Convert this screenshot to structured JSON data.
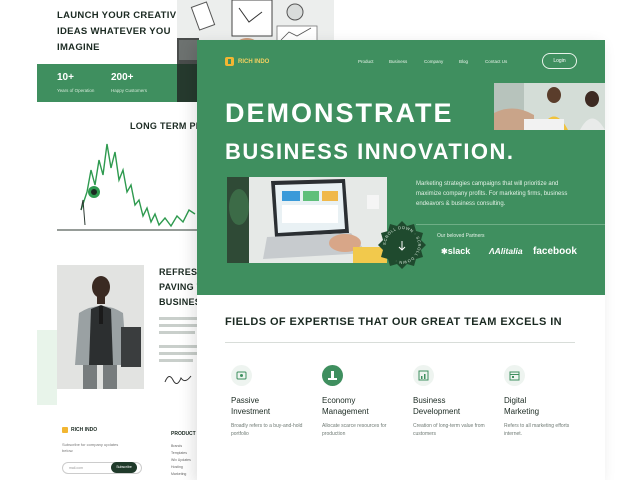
{
  "back_page": {
    "hero_title": "LAUNCH YOUR CREATIVE IDEAS WHATEVER YOU IMAGINE",
    "stats": [
      {
        "value": "10+",
        "label": "Years of Operation"
      },
      {
        "value": "200+",
        "label": "Happy Customers"
      }
    ],
    "chart_title": "LONG TERM PL",
    "refresh_title_lines": [
      "REFRESH",
      "PAVING T",
      "BUSINES"
    ],
    "footer": {
      "brand": "RICH INDO",
      "subscribe_text": "Subscribe for company updates below.",
      "email_placeholder": "mail.com",
      "subscribe_button": "Subscribe",
      "column_title": "PRODUCT",
      "links": [
        "Brands",
        "Templates",
        "Wix Updates",
        "Hosting",
        "Marketing"
      ]
    }
  },
  "front_page": {
    "brand": "RICH INDO",
    "nav": [
      "Product",
      "Business",
      "Company",
      "Blog",
      "Contact Us"
    ],
    "login": "Login",
    "title_line1": "DEMONSTRATE",
    "title_line2": "BUSINESS INNOVATION.",
    "hero_text": "Marketing strategies campaigns that will prioritize and maximize company profits. For marketing firms, business endeavors & business consulting.",
    "partners_label": "Our beloved Partners",
    "partners": [
      "slack",
      "Alitalia",
      "facebook"
    ],
    "badge_text": "SCROLL DOWN · SCROLL DOWN ·",
    "fields_title": "FIELDS OF EXPERTISE THAT OUR GREAT TEAM EXCELS IN",
    "cards": [
      {
        "title_line1": "Passive",
        "title_line2": "Investment",
        "desc": "Broadly refers to a buy-and-hold portfolio",
        "icon": "money-icon"
      },
      {
        "title_line1": "Economy",
        "title_line2": "Management",
        "desc": "Allocate scarce resources for production",
        "icon": "bank-icon"
      },
      {
        "title_line1": "Business",
        "title_line2": "Development",
        "desc": "Creation of long-term value from customers",
        "icon": "chart-icon"
      },
      {
        "title_line1": "Digital",
        "title_line2": "Marketing",
        "desc": "Refers to all marketing efforts internet.",
        "icon": "calendar-icon"
      }
    ],
    "colors": {
      "primary": "#3f8f5f",
      "accent": "#f2b632",
      "dark": "#1b2a22"
    }
  }
}
